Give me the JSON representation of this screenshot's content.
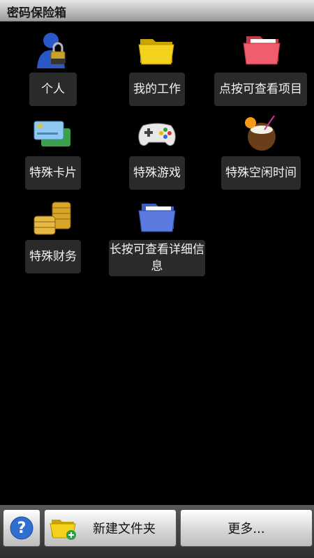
{
  "app": {
    "title": "密码保险箱"
  },
  "items": [
    {
      "label": "个人",
      "icon": "user-lock-icon"
    },
    {
      "label": "我的工作",
      "icon": "yellow-folder-icon"
    },
    {
      "label": "点按可查看项目",
      "icon": "pink-folder-icon"
    },
    {
      "label": "特殊卡片",
      "icon": "credit-cards-icon"
    },
    {
      "label": "特殊游戏",
      "icon": "gamepad-icon"
    },
    {
      "label": "特殊空闲时间",
      "icon": "coconut-drink-icon"
    },
    {
      "label": "特殊财务",
      "icon": "coins-icon"
    },
    {
      "label": "长按可查看详细信息",
      "icon": "blue-folder-icon"
    }
  ],
  "bottom": {
    "new_folder_label": "新建文件夹",
    "more_label": "更多..."
  },
  "colors": {
    "background": "#000000",
    "label_bg": "#2a2a2a",
    "folder_yellow": "#f2d21c",
    "folder_pink": "#f05d6c",
    "folder_blue": "#5b7be0"
  }
}
